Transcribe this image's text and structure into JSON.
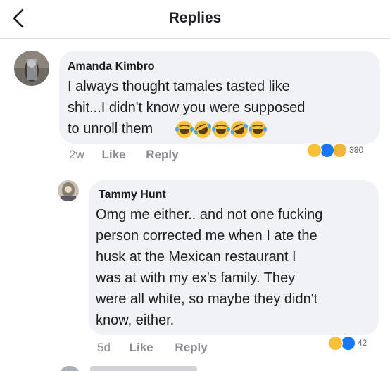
{
  "header": {
    "title": "Replies",
    "back_icon": "chevron-left-icon"
  },
  "comment": {
    "author": "Amanda Kimbro",
    "text_lines": [
      "I always thought tamales tasted like",
      "shit...I didn't know you were supposed",
      "to unroll them"
    ],
    "inline_emojis": [
      "laughing-face",
      "rolling-laughing-face",
      "laughing-face",
      "rolling-laughing-face",
      "laughing-face"
    ],
    "time": "2w",
    "like_label": "Like",
    "reply_label": "Reply",
    "reactions": [
      "haha",
      "like",
      "wow"
    ],
    "reaction_count": "380"
  },
  "reply": {
    "author": "Tammy Hunt",
    "text_lines": [
      "Omg me either.. and not one fucking",
      "person corrected me when I ate the",
      "husk at the Mexican restaurant I",
      "was at with my ex's family. They",
      "were all white, so maybe they didn't",
      "know, either."
    ],
    "time": "5d",
    "like_label": "Like",
    "reply_label": "Reply",
    "reactions": [
      "haha",
      "like"
    ],
    "reaction_count": "42"
  },
  "colors": {
    "bubble": "#f0f2f5",
    "meta": "#8a8d91",
    "like_blue": "#1877f2",
    "haha_yellow": "#f7c13b"
  }
}
